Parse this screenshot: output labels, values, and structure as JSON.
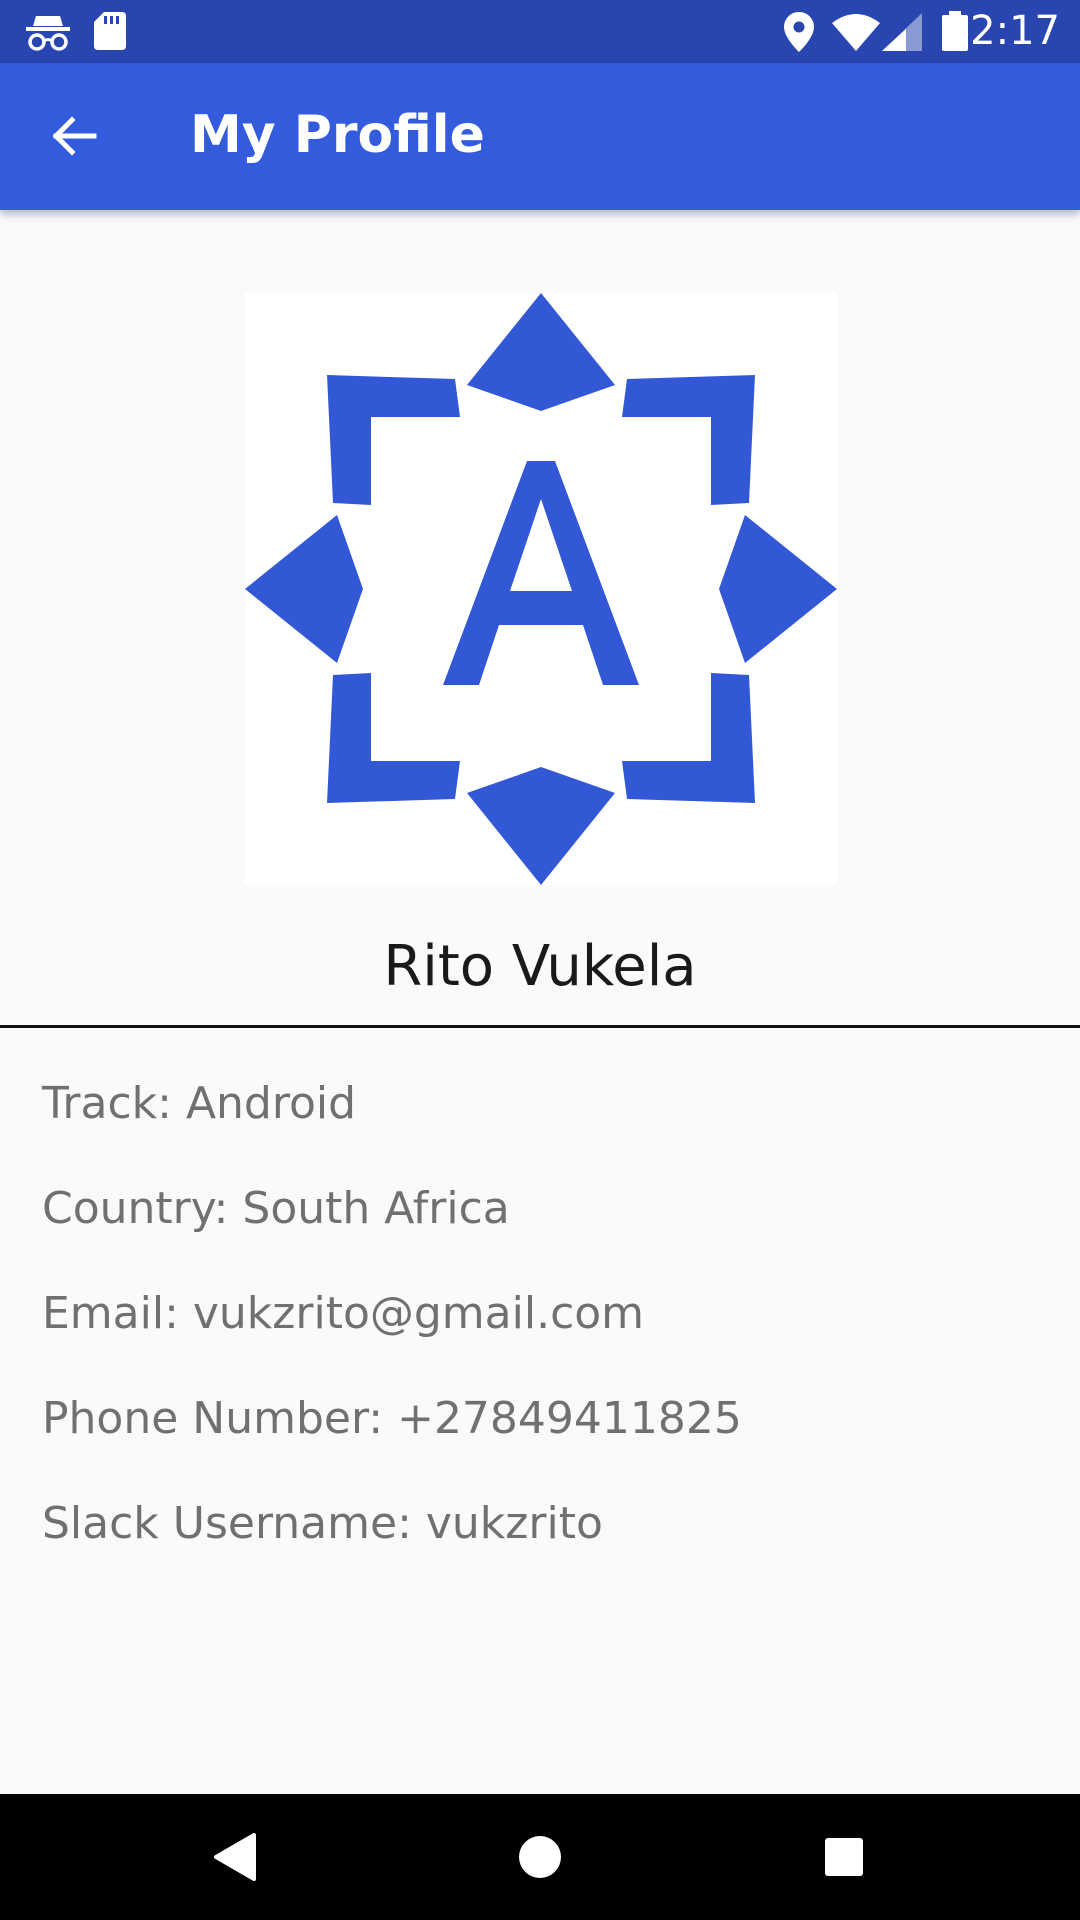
{
  "status_bar": {
    "time": "2:17",
    "left_icons": [
      "incognito-icon",
      "sd-card-icon"
    ],
    "right_icons": [
      "location-icon",
      "wifi-icon",
      "cell-signal-icon",
      "battery-icon"
    ]
  },
  "app_bar": {
    "title": "My Profile",
    "back_icon": "arrow-back-icon"
  },
  "colors": {
    "status_bar": "#2845b0",
    "app_bar": "#335bdb",
    "logo_blue": "#3358d6",
    "background": "#fafafa",
    "info_text": "#707070"
  },
  "profile": {
    "avatar_icon": "star-a-logo-icon",
    "avatar_letter": "A",
    "name": "Rito Vukela",
    "details": [
      "Track: Android",
      "Country: South Africa",
      "Email: vukzrito@gmail.com",
      "Phone Number: +27849411825",
      "Slack Username: vukzrito"
    ]
  },
  "nav_bar": {
    "buttons": [
      "back-triangle-icon",
      "home-circle-icon",
      "recents-square-icon"
    ]
  }
}
